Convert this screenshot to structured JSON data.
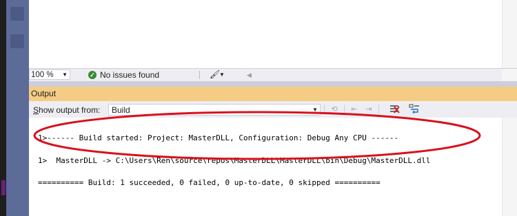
{
  "editor": {
    "zoom": "100 %",
    "issues_label": "No issues found"
  },
  "output": {
    "title": "Output",
    "show_output_from_prefix": "S",
    "show_output_from_rest": "how output from:",
    "source": "Build",
    "lines": [
      "1>------ Build started: Project: MasterDLL, Configuration: Debug Any CPU ------",
      "1>  MasterDLL -> C:\\Users\\Ren\\source\\repos\\MasterDLL\\MasterDLL\\bin\\Debug\\MasterDLL.dll",
      "========== Build: 1 succeeded, 0 failed, 0 up-to-date, 0 skipped =========="
    ]
  },
  "annotation": {
    "color": "#d9101c"
  },
  "icons": {
    "issues": "check-circle-icon",
    "brush": "brush-icon",
    "find_message": "find-message-icon",
    "clear_all": "clear-all-icon",
    "word_wrap": "word-wrap-icon"
  }
}
